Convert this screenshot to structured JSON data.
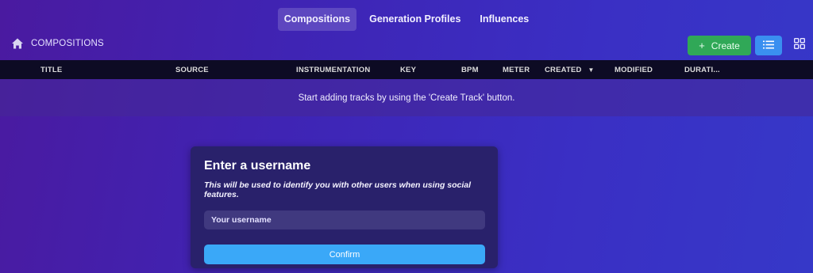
{
  "nav": {
    "tabs": [
      {
        "label": "Compositions",
        "active": true
      },
      {
        "label": "Generation Profiles",
        "active": false
      },
      {
        "label": "Influences",
        "active": false
      }
    ]
  },
  "breadcrumb": {
    "icon": "home-icon",
    "label": "COMPOSITIONS"
  },
  "toolbar": {
    "create_label": "Create",
    "create_icon": "plus-icon",
    "list_view_icon": "list-icon",
    "grid_view_icon": "grid-icon"
  },
  "table": {
    "columns": [
      "TITLE",
      "SOURCE",
      "INSTRUMENTATION",
      "KEY",
      "BPM",
      "METER",
      "CREATED",
      "MODIFIED",
      "DURATI..."
    ],
    "sorted_column": "CREATED",
    "sort_direction": "descending",
    "empty_message": "Start adding tracks by using the 'Create Track' button."
  },
  "modal": {
    "title": "Enter a username",
    "description": "This will be used to identify you with other users when using social features.",
    "input_placeholder": "Your username",
    "input_value": "",
    "confirm_label": "Confirm"
  },
  "colors": {
    "create_button": "#30a857",
    "list_button": "#3a8ff0",
    "confirm_button": "#3aa8f8",
    "table_header": "#0d0b24",
    "modal_bg": "#29216b"
  }
}
